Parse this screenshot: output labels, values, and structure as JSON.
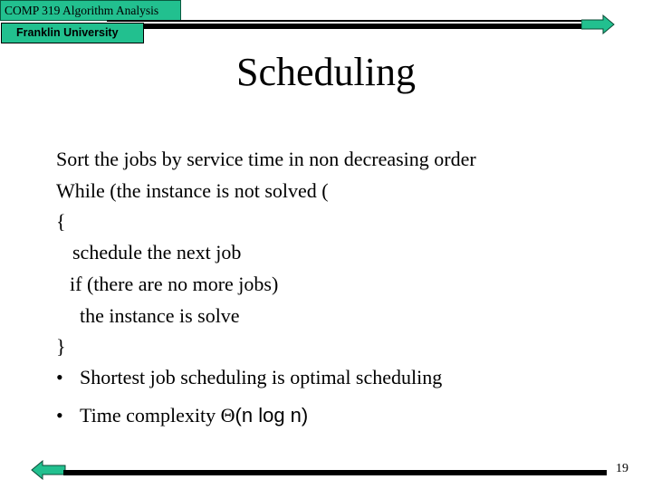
{
  "header": {
    "course": "COMP 319 Algorithm Analysis",
    "university": "Franklin University"
  },
  "title": "Scheduling",
  "content": {
    "lines": [
      "Sort the jobs by service time in non decreasing order",
      "While (the instance is not solved (",
      "{",
      "schedule the next job",
      "if (there are no more jobs)",
      "the instance is solve",
      "}"
    ],
    "bullets": [
      {
        "symbol": "•",
        "text": "Shortest job scheduling is optimal scheduling"
      },
      {
        "symbol": "•",
        "text_prefix": "Time complexity ",
        "theta": "Θ",
        "text_suffix": "(n log n)"
      }
    ]
  },
  "footer": {
    "page_number": "19"
  },
  "navigation": {
    "next_icon": "right-arrow-icon",
    "prev_icon": "left-arrow-icon"
  },
  "colors": {
    "accent_green": "#22c08f",
    "rule": "#000000"
  }
}
